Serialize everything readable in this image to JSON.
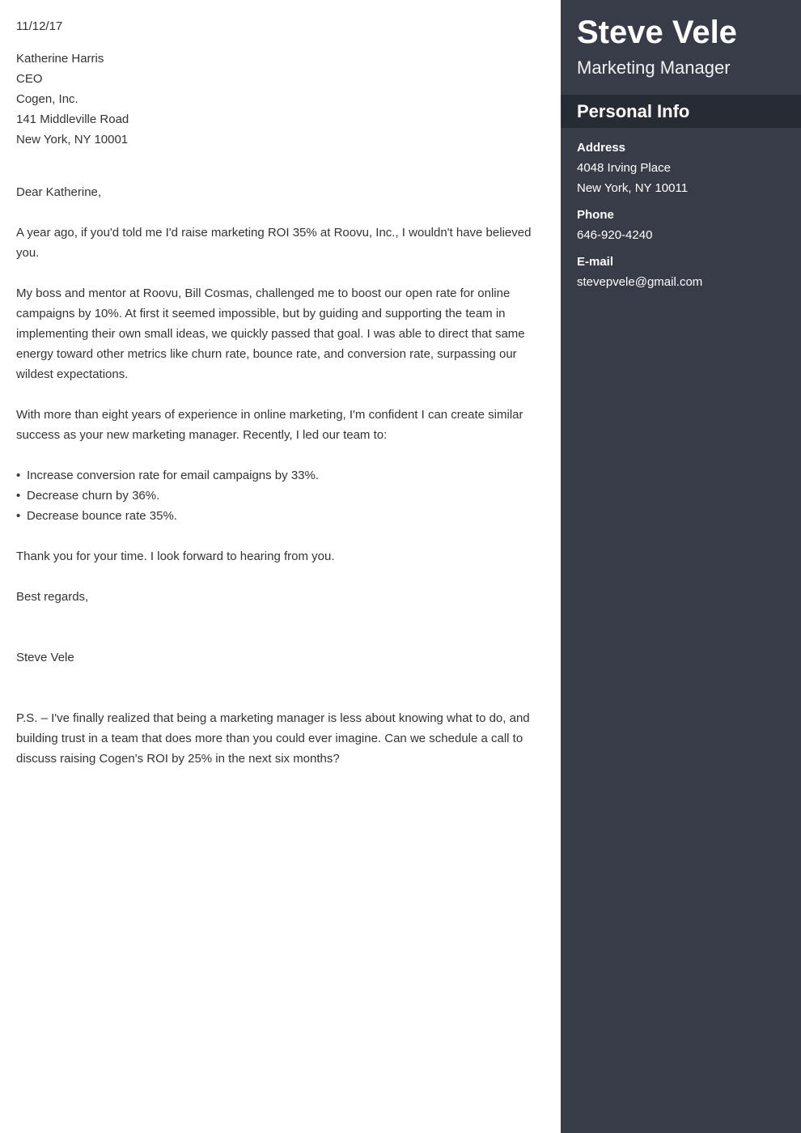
{
  "letter": {
    "date": "11/12/17",
    "recipient": {
      "name": "Katherine Harris",
      "title": "CEO",
      "company": "Cogen, Inc.",
      "street": "141 Middleville Road",
      "city_state_zip": "New York, NY 10001"
    },
    "salutation": "Dear Katherine,",
    "paragraphs": [
      "A year ago, if you'd told me I'd raise marketing ROI 35% at Roovu, Inc., I wouldn't have believed you.",
      "My boss and mentor at Roovu, Bill Cosmas, challenged me to boost our open rate for online campaigns by 10%. At first it seemed impossible, but by guiding and supporting the team in implementing their own small ideas, we quickly passed that goal. I was able to direct that same energy toward other metrics like churn rate, bounce rate, and conversion rate, surpassing our wildest expectations.",
      "With more than eight years of experience in online marketing, I'm confident I can create similar success as your new marketing manager. Recently, I led our team to:"
    ],
    "bullet_char": "•",
    "bullets": [
      "Increase conversion rate for email campaigns by 33%.",
      "Decrease churn by 36%.",
      "Decrease bounce rate 35%."
    ],
    "thanks": "Thank you for your time. I look forward to hearing from you.",
    "closing": "Best regards,",
    "signature": "Steve Vele",
    "ps": "P.S. – I've finally realized that being a marketing manager is less about knowing what to do, and building trust in a team that does more than you could ever imagine. Can we schedule a call to discuss raising Cogen's ROI by 25% in the next six months?"
  },
  "sidebar": {
    "name": "Steve Vele",
    "job_title": "Marketing Manager",
    "section_title": "Personal Info",
    "address": {
      "label": "Address",
      "line1": "4048 Irving Place",
      "line2": "New York, NY 10011"
    },
    "phone": {
      "label": "Phone",
      "value": "646-920-4240"
    },
    "email": {
      "label": "E-mail",
      "value": "stevepvele@gmail.com"
    }
  },
  "colors": {
    "sidebar_bg": "#373c48",
    "section_header_bg": "#272b33",
    "body_text": "#333333"
  }
}
